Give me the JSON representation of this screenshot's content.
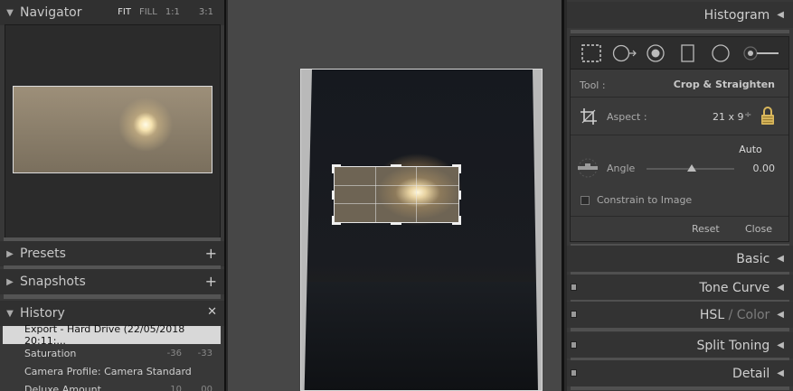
{
  "left": {
    "navigator": {
      "title": "Navigator",
      "zoom_options": [
        "FIT",
        "FILL",
        "1:1",
        "3:1"
      ],
      "active_zoom": "FIT"
    },
    "presets": {
      "title": "Presets",
      "add": "+"
    },
    "snapshots": {
      "title": "Snapshots",
      "add": "+"
    },
    "history": {
      "title": "History",
      "clear": "✕",
      "items": [
        {
          "label": "Export - Hard Drive (22/05/2018 20:11:...",
          "v1": "",
          "v2": ""
        },
        {
          "label": "Saturation",
          "v1": "-36",
          "v2": "-33"
        },
        {
          "label": "Camera Profile: Camera Standard",
          "v1": "",
          "v2": ""
        },
        {
          "label": "Deluxe Amount",
          "v1": "10",
          "v2": "00"
        }
      ]
    }
  },
  "right": {
    "histogram": {
      "title": "Histogram"
    },
    "tool_panel": {
      "tool_label": "Tool :",
      "tool_value": "Crop & Straighten",
      "aspect_label": "Aspect :",
      "aspect_value": "21 x 9",
      "aspect_caret": "÷",
      "auto_label": "Auto",
      "angle_label": "Angle",
      "angle_value": "0.00",
      "constrain_label": "Constrain to Image",
      "reset_label": "Reset",
      "close_label": "Close",
      "tools": [
        "crop-overlay-icon",
        "spot-removal-icon",
        "red-eye-icon",
        "graduated-filter-icon",
        "radial-filter-icon",
        "adjustment-brush-icon"
      ]
    },
    "panels": [
      {
        "title": "Basic",
        "dim": ""
      },
      {
        "title": "Tone Curve",
        "dim": ""
      },
      {
        "title": "HSL",
        "dim": " / Color"
      },
      {
        "title": "Split Toning",
        "dim": ""
      },
      {
        "title": "Detail",
        "dim": ""
      }
    ]
  },
  "colors": {
    "panel_bg": "#383838",
    "center_bg": "#474747",
    "selected_row": "#d8d8d8"
  }
}
